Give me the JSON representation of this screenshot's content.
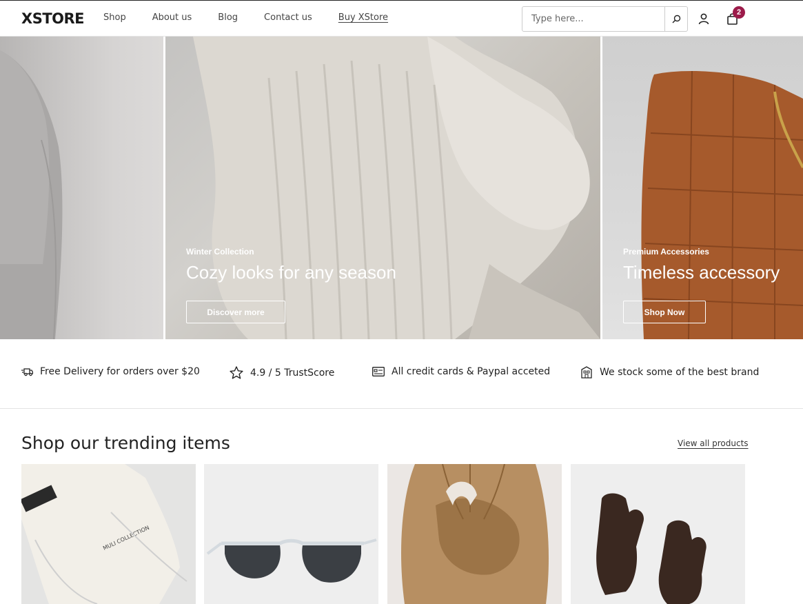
{
  "header": {
    "logo": "XSTORE",
    "nav": [
      "Shop",
      "About us",
      "Blog",
      "Contact us",
      "Buy XStore"
    ],
    "search_placeholder": "Type here...",
    "cart_count": "2"
  },
  "hero": {
    "slides": [
      {
        "eyebrow": "",
        "title": "",
        "button": ""
      },
      {
        "eyebrow": "Winter Collection",
        "title": "Cozy looks for any season",
        "button": "Discover more"
      },
      {
        "eyebrow": "Premium Accessories",
        "title": "Timeless accessory",
        "button": "Shop Now"
      }
    ]
  },
  "features": [
    {
      "icon": "truck-icon",
      "text": "Free Delivery for orders over $20"
    },
    {
      "icon": "star-icon",
      "text": "4.9 / 5 TrustScore"
    },
    {
      "icon": "credit-card-icon",
      "text": "All credit cards & Paypal acceted"
    },
    {
      "icon": "store-icon",
      "text": "We stock some of the best brand"
    }
  ],
  "trending": {
    "title": "Shop our trending items",
    "view_all": "View all products",
    "products": [
      {
        "image": "necklace-pouch"
      },
      {
        "image": "sunglasses"
      },
      {
        "image": "hair-clip"
      },
      {
        "image": "gloves"
      }
    ]
  },
  "colors": {
    "accent": "#9c1b4a",
    "text": "#222222",
    "border": "#e3e3e3"
  }
}
